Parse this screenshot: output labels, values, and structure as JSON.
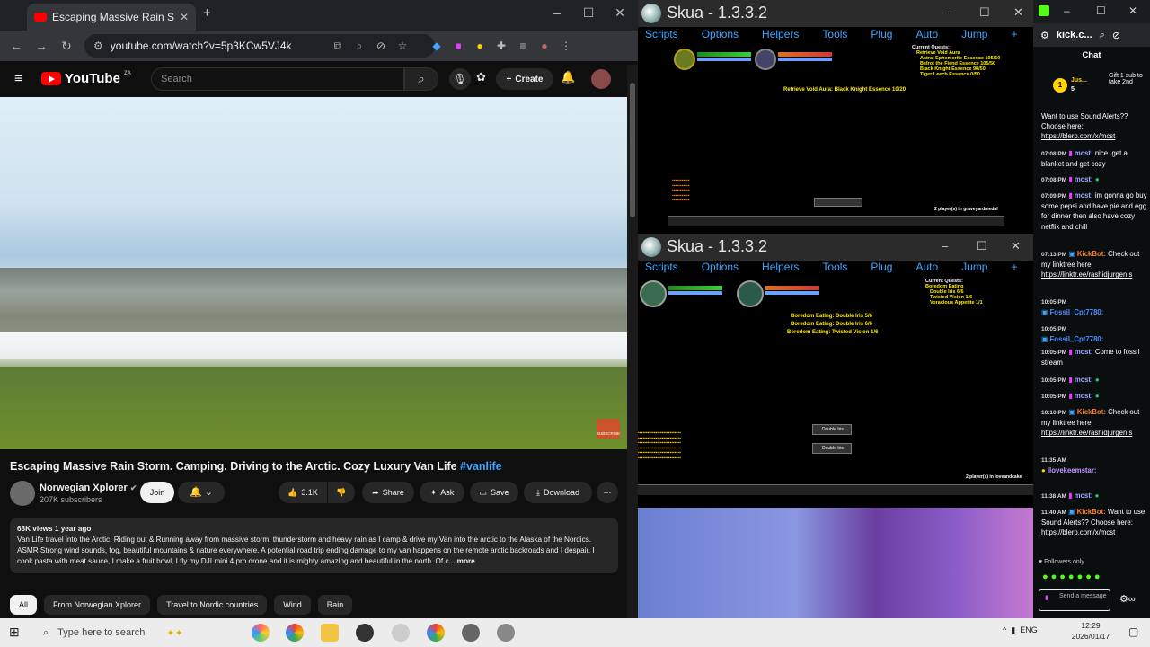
{
  "chrome": {
    "tab_title": "Escaping Massive Rain Storm",
    "url": "youtube.com/watch?v=5p3KCw5VJ4k",
    "window_min": "–",
    "window_max": "☐",
    "window_close": "✕",
    "new_tab": "+"
  },
  "youtube": {
    "logo": "YouTube",
    "logo_country": "ZA",
    "search_placeholder": "Search",
    "create_label": "Create",
    "video_title": "Escaping Massive Rain Storm. Camping. Driving to the Arctic. Cozy Luxury Van Life",
    "video_hashtag": "#vanlife",
    "channel_name": "Norwegian Xplorer",
    "subscribers": "207K subscribers",
    "join_label": "Join",
    "like_count": "3.1K",
    "share_label": "Share",
    "ask_label": "Ask",
    "save_label": "Save",
    "download_label": "Download",
    "description_meta": "63K views  1 year ago",
    "description": "Van Life travel into the Arctic. Riding out & Running away from massive storm, thunderstorm and heavy rain as I camp & drive my Van into the arctic to the Alaska of the Nordics. ASMR Strong wind sounds, fog, beautiful mountains & nature everywhere. A potential road trip ending damage to my van happens on the remote arctic backroads and I despair. I cook pasta with meat sauce, I make a fruit bowl, I fly my DJI mini 4 pro drone and it is mighty amazing and beautiful in the north. Of c",
    "more_label": "...more",
    "chips": [
      "All",
      "From Norwegian Xplorer",
      "Travel to Nordic countries",
      "Wind",
      "Rain"
    ],
    "watermark": "SUBSCRIBE"
  },
  "skua_top": {
    "title": "Skua - 1.3.3.2",
    "menu": [
      "Scripts",
      "Options",
      "Helpers",
      "Tools",
      "Plug",
      "Auto",
      "Jump",
      "+"
    ],
    "quest_header": "Current Quests:",
    "quests": [
      "Retrieve Void Aura",
      "Astral Ephemerite Essence 105/50",
      "Belrot the Fiend Essence 105/50",
      "Black Knight Essence 98/50",
      "Tiger Leech Essence 0/50"
    ],
    "center_text": "Retrieve Void Aura: Black Knight Essence 10/20",
    "players": "2 player(s) in graveyardmedal"
  },
  "skua_bottom": {
    "title": "Skua - 1.3.3.2",
    "menu": [
      "Scripts",
      "Options",
      "Helpers",
      "Tools",
      "Plug",
      "Auto",
      "Jump",
      "+"
    ],
    "quest_header": "Current Quests:",
    "quests": [
      "Boredom Eating",
      "Double Iris 6/6",
      "Twisted Vision 1/6",
      "Voracious Appetite 1/1"
    ],
    "center_lines": [
      "Boredom Eating: Double Iris 5/6",
      "Boredom Eating: Double Iris 6/6",
      "Boredom Eating: Twisted Vision 1/6"
    ],
    "drops": [
      "Double Iris",
      "Double Iris"
    ],
    "players": "2 player(s) in loveandcake"
  },
  "kick": {
    "title": "kick.c...",
    "chat_label": "Chat",
    "gift_user": "Jus...",
    "gift_count": "5",
    "gift_text": "Gift 1 sub to take 2nd",
    "messages": [
      {
        "time": "",
        "user": "",
        "text": "Want to use Sound Alerts?? Choose here:",
        "link": "https://blerp.com/x/mcst"
      },
      {
        "time": "07:08 PM",
        "user": "mcst:",
        "text": "nice. get a blanket and get cozy",
        "link": ""
      },
      {
        "time": "07:08 PM",
        "user": "mcst:",
        "text": "",
        "link": ""
      },
      {
        "time": "07:09 PM",
        "user": "mcst:",
        "text": "im gonna go buy some pepsi and have pie and egg for dinner then also have cozy netflix and chill",
        "link": ""
      },
      {
        "time": "07:13 PM",
        "user": "KickBot:",
        "text": "Check out my linktree here:",
        "link": "https://linktr.ee/rashidjurgen s"
      },
      {
        "time": "10:05 PM",
        "user": "Fossil_Cpt7780:",
        "text": "",
        "link": ""
      },
      {
        "time": "10:05 PM",
        "user": "Fossil_Cpt7780:",
        "text": "",
        "link": ""
      },
      {
        "time": "10:05 PM",
        "user": "mcst:",
        "text": "Come to fossil stream",
        "link": ""
      },
      {
        "time": "10:05 PM",
        "user": "mcst:",
        "text": "",
        "link": ""
      },
      {
        "time": "10:05 PM",
        "user": "mcst:",
        "text": "",
        "link": ""
      },
      {
        "time": "10:10 PM",
        "user": "KickBot:",
        "text": "Check out my linktree here:",
        "link": "https://linktr.ee/rashidjurgen s"
      },
      {
        "time": "11:35 AM",
        "user": "ilovekeemstar:",
        "text": "",
        "link": ""
      },
      {
        "time": "11:38 AM",
        "user": "mcst:",
        "text": "",
        "link": ""
      },
      {
        "time": "11:40 AM",
        "user": "KickBot:",
        "text": "Want to use Sound Alerts?? Choose here:",
        "link": "https://blerp.com/x/mcst"
      }
    ],
    "followers_only": "Followers only",
    "send_placeholder": "Send a message"
  },
  "taskbar": {
    "search_placeholder": "Type here to search",
    "language": "ENG",
    "time": "12:29",
    "date": "2026/01/17"
  },
  "colors": {
    "youtube_red": "#ff0000",
    "skua_menu": "#3fa7ff",
    "quest_yellow": "#ffef00",
    "kick_green": "#53fc18",
    "link_blue": "#3ea6ff"
  }
}
